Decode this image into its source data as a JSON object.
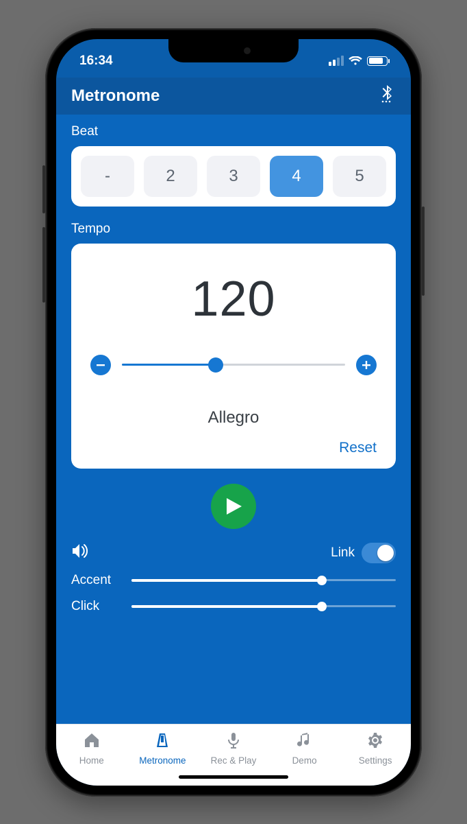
{
  "status": {
    "time": "16:34"
  },
  "header": {
    "title": "Metronome"
  },
  "beat": {
    "label": "Beat",
    "options": [
      "-",
      "2",
      "3",
      "4",
      "5"
    ],
    "selected_index": 3
  },
  "tempo": {
    "label": "Tempo",
    "value": "120",
    "name": "Allegro",
    "reset_label": "Reset",
    "slider_percent": 42
  },
  "volume": {
    "link_label": "Link",
    "link_on": true,
    "accent": {
      "label": "Accent",
      "percent": 72
    },
    "click": {
      "label": "Click",
      "percent": 72
    }
  },
  "tabs": {
    "items": [
      {
        "label": "Home"
      },
      {
        "label": "Metronome"
      },
      {
        "label": "Rec & Play"
      },
      {
        "label": "Demo"
      },
      {
        "label": "Settings"
      }
    ],
    "active_index": 1
  }
}
